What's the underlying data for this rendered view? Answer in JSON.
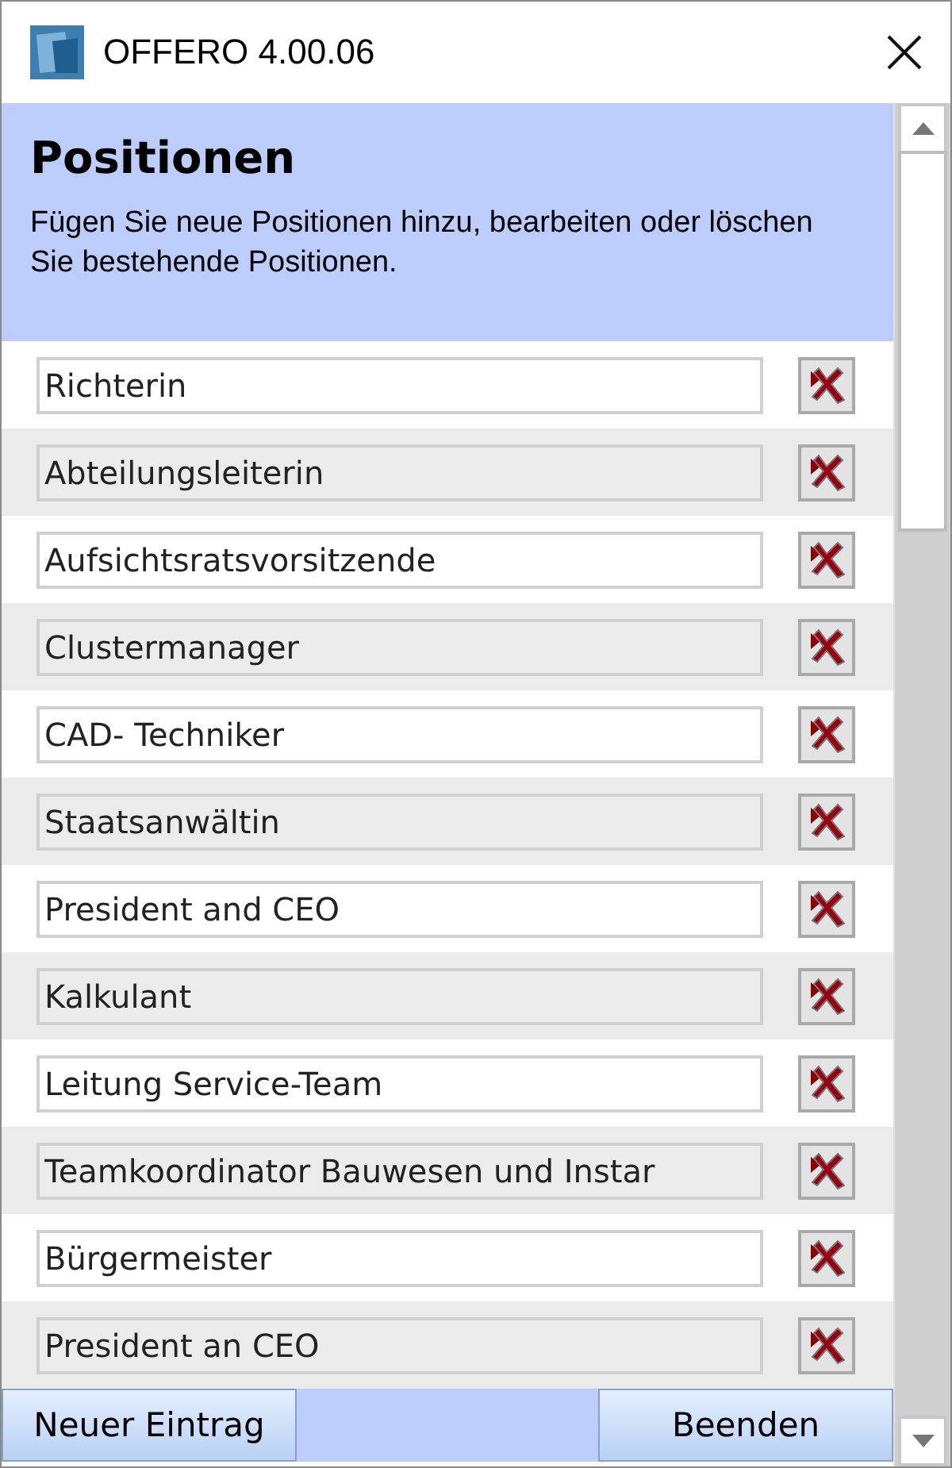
{
  "window": {
    "title": "OFFERO 4.00.06"
  },
  "header": {
    "title": "Positionen",
    "description": "Fügen Sie neue Positionen hinzu, bearbeiten oder löschen Sie bestehende Positionen."
  },
  "positions": [
    {
      "value": "Richterin"
    },
    {
      "value": "Abteilungsleiterin"
    },
    {
      "value": "Aufsichtsratsvorsitzende"
    },
    {
      "value": "Clustermanager"
    },
    {
      "value": "CAD- Techniker"
    },
    {
      "value": "Staatsanwältin"
    },
    {
      "value": "President and CEO"
    },
    {
      "value": "Kalkulant"
    },
    {
      "value": "Leitung Service-Team"
    },
    {
      "value": "Teamkoordinator Bauwesen und Instar"
    },
    {
      "value": "Bürgermeister"
    },
    {
      "value": "President an CEO"
    }
  ],
  "buttons": {
    "new": "Neuer Eintrag",
    "close": "Beenden"
  }
}
